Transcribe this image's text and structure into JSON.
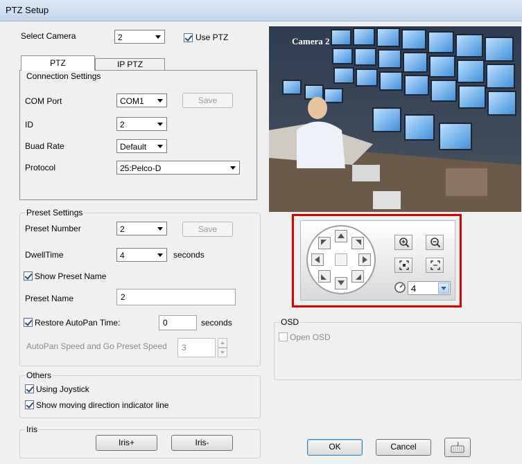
{
  "window": {
    "title": "PTZ Setup"
  },
  "camera": {
    "label": "Select Camera",
    "value": "2",
    "use_ptz_label": "Use PTZ",
    "use_ptz_checked": true
  },
  "tabs": [
    {
      "label": "PTZ",
      "active": true
    },
    {
      "label": "IP PTZ",
      "active": false
    }
  ],
  "connection": {
    "title": "Connection Settings",
    "com_port_label": "COM Port",
    "com_port_value": "COM1",
    "save_label": "Save",
    "id_label": "ID",
    "id_value": "2",
    "baud_label": "Buad Rate",
    "baud_value": "Default",
    "protocol_label": "Protocol",
    "protocol_value": "25:Pelco-D"
  },
  "preset": {
    "title": "Preset Settings",
    "number_label": "Preset Number",
    "number_value": "2",
    "save_label": "Save",
    "dwell_label": "DwellTime",
    "dwell_value": "4",
    "dwell_unit": "seconds",
    "show_name_label": "Show Preset Name",
    "show_name_checked": true,
    "name_label": "Preset Name",
    "name_value": "2",
    "restore_label": "Restore AutoPan Time:",
    "restore_checked": true,
    "restore_value": "0",
    "restore_unit": "seconds",
    "speed_label": "AutoPan Speed and Go Preset Speed",
    "speed_value": "3"
  },
  "others": {
    "title": "Others",
    "joystick_label": "Using Joystick",
    "joystick_checked": true,
    "direction_label": "Show moving direction indicator line",
    "direction_checked": true
  },
  "iris": {
    "title": "Iris",
    "plus_label": "Iris+",
    "minus_label": "Iris-"
  },
  "video": {
    "camera_label": "Camera 2"
  },
  "ptz_control": {
    "speed_value": "4",
    "highlight_color": "#e00000"
  },
  "osd": {
    "title": "OSD",
    "open_label": "Open OSD",
    "open_checked": false
  },
  "footer": {
    "ok_label": "OK",
    "cancel_label": "Cancel"
  }
}
